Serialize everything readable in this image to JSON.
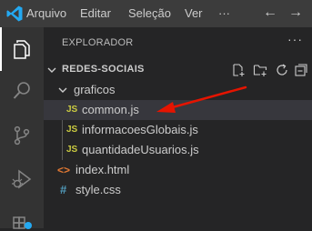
{
  "menu": {
    "items": [
      {
        "label": "Arquivo"
      },
      {
        "label": "Editar"
      },
      {
        "label": "Seleção"
      },
      {
        "label": "Ver"
      }
    ],
    "more": "···"
  },
  "sidebar": {
    "title": "EXPLORADOR",
    "more": "···",
    "section": {
      "title": "REDES-SOCIAIS"
    },
    "tree": {
      "folder": {
        "label": "graficos"
      },
      "files": [
        {
          "label": "common.js",
          "icon": "JS"
        },
        {
          "label": "informacoesGlobais.js",
          "icon": "JS"
        },
        {
          "label": "quantidadeUsuarios.js",
          "icon": "JS"
        }
      ],
      "html_file": {
        "label": "index.html"
      },
      "css_file": {
        "label": "style.css"
      }
    }
  },
  "colors": {
    "accent_blue": "#23a9f2",
    "js_yellow": "#cbcb41",
    "html_orange": "#e37933",
    "css_blue": "#519aba",
    "annotation_red": "#e51400"
  }
}
